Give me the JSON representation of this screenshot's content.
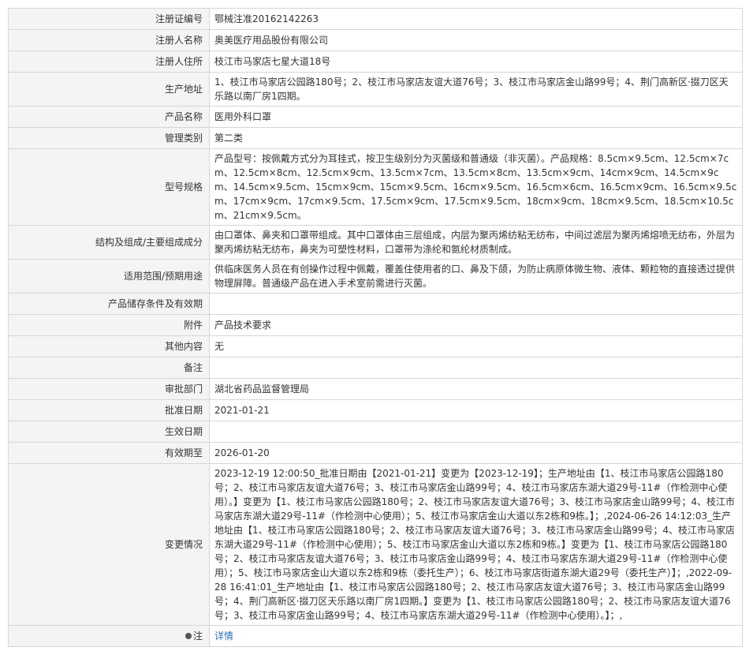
{
  "rows": [
    {
      "label": "注册证编号",
      "value": "鄂械注准20162142263"
    },
    {
      "label": "注册人名称",
      "value": "奥美医疗用品股份有限公司"
    },
    {
      "label": "注册人住所",
      "value": "枝江市马家店七星大道18号"
    },
    {
      "label": "生产地址",
      "value": "1、枝江市马家店公园路180号；2、枝江市马家店友谊大道76号；3、枝江市马家店金山路99号；4、荆门高新区·掇刀区天乐路以南厂房1四期。"
    },
    {
      "label": "产品名称",
      "value": "医用外科口罩"
    },
    {
      "label": "管理类别",
      "value": "第二类"
    },
    {
      "label": "型号规格",
      "value": "产品型号：按佩戴方式分为耳挂式，按卫生级别分为灭菌级和普通级（非灭菌）。产品规格：8.5cm×9.5cm、12.5cm×7cm、12.5cm×8cm、12.5cm×9cm、13.5cm×7cm、13.5cm×8cm、13.5cm×9cm、14cm×9cm、14.5cm×9cm、14.5cm×9.5cm、15cm×9cm、15cm×9.5cm、16cm×9.5cm、16.5cm×6cm、16.5cm×9cm、16.5cm×9.5cm、17cm×9cm、17cm×9.5cm、17.5cm×9cm、17.5cm×9.5cm、18cm×9cm、18cm×9.5cm、18.5cm×10.5cm、21cm×9.5cm。"
    },
    {
      "label": "结构及组成/主要组成成分",
      "value": "由口罩体、鼻夹和口罩带组成。其中口罩体由三层组成，内层为聚丙烯纺粘无纺布，中间过滤层为聚丙烯熔喷无纺布，外层为聚丙烯纺粘无纺布，鼻夹为可塑性材料，口罩带为涤纶和氨纶材质制成。"
    },
    {
      "label": "适用范围/预期用途",
      "value": "供临床医务人员在有创操作过程中佩戴，覆盖住使用者的口、鼻及下颌，为防止病原体微生物、液体、颗粒物的直接透过提供物理屏障。普通级产品在进入手术室前需进行灭菌。"
    },
    {
      "label": "产品储存条件及有效期",
      "value": ""
    },
    {
      "label": "附件",
      "value": "产品技术要求"
    },
    {
      "label": "其他内容",
      "value": "无"
    },
    {
      "label": "备注",
      "value": ""
    },
    {
      "label": "审批部门",
      "value": "湖北省药品监督管理局"
    },
    {
      "label": "批准日期",
      "value": "2021-01-21"
    },
    {
      "label": "生效日期",
      "value": ""
    },
    {
      "label": "有效期至",
      "value": "2026-01-20"
    },
    {
      "label": "变更情况",
      "value": "2023-12-19 12:00:50_批准日期由【2021-01-21】变更为【2023-12-19】；生产地址由【1、枝江市马家店公园路180号；2、枝江市马家店友谊大道76号；3、枝江市马家店金山路99号；4、枝江市马家店东湖大道29号-11#（作检测中心使用）。】变更为【1、枝江市马家店公园路180号；2、枝江市马家店友谊大道76号；3、枝江市马家店金山路99号；4、枝江市马家店东湖大道29号-11#（作检测中心使用）；5、枝江市马家店金山大道以东2栋和9栋。】；,2024-06-26 14:12:03_生产地址由【1、枝江市马家店公园路180号；2、枝江市马家店友谊大道76号；3、枝江市马家店金山路99号；4、枝江市马家店东湖大道29号-11#（作检测中心使用）；5、枝江市马家店金山大道以东2栋和9栋。】变更为【1、枝江市马家店公园路180号；2、枝江市马家店友谊大道76号；3、枝江市马家店金山路99号；4、枝江市马家店东湖大道29号-11#（作检测中心使用）；5、枝江市马家店金山大道以东2栋和9栋（委托生产）；6、枝江市马家店街道东湖大道29号（委托生产）】；,2022-09-28 16:41:01_生产地址由【1、枝江市马家店公园路180号；2、枝江市马家店友谊大道76号；3、枝江市马家店金山路99号；4、荆门高新区·掇刀区天乐路以南厂房1四期。】变更为【1、枝江市马家店公园路180号；2、枝江市马家店友谊大道76号；3、枝江市马家店金山路99号；4、枝江市马家店东湖大道29号-11#（作检测中心使用）。】；,"
    }
  ],
  "note": {
    "label": "注",
    "icon": "pin-icon",
    "link_text": "详情"
  }
}
